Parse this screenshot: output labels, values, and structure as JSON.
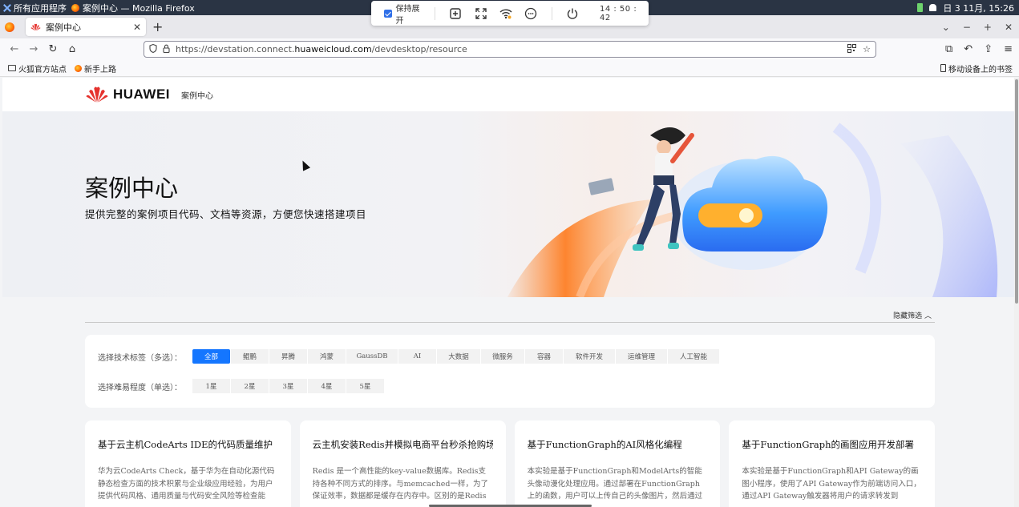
{
  "os": {
    "apps_label": "所有应用程序",
    "window_title": "案例中心 — Mozilla Firefox",
    "datetime": "日 3 11月, 15:26"
  },
  "remote_toolbar": {
    "keep_expanded": "保持展开",
    "clock": "14 : 50 : 42"
  },
  "browser": {
    "tab_title": "案例中心",
    "url_prefix": "https://devstation.connect.",
    "url_domain": "huaweicloud.com",
    "url_path": "/devdesktop/resource",
    "bookmarks": [
      "火狐官方站点",
      "新手上路"
    ],
    "mobile_bookmarks": "移动设备上的书签"
  },
  "site": {
    "brand": "HUAWEI",
    "section": "案例中心",
    "banner_title": "案例中心",
    "banner_subtitle": "提供完整的案例项目代码、文档等资源，方便您快速搭建项目",
    "toggle_filter": "隐藏筛选 ︿"
  },
  "filters": {
    "tech_label": "选择技术标签（多选）：",
    "tech_tags": [
      "全部",
      "鲲鹏",
      "昇腾",
      "鸿蒙",
      "GaussDB",
      "AI",
      "大数据",
      "微服务",
      "容器",
      "软件开发",
      "运维管理",
      "人工智能"
    ],
    "difficulty_label": "选择难易程度（单选）：",
    "difficulty_tags": [
      "1星",
      "2星",
      "3星",
      "4星",
      "5星"
    ]
  },
  "cards": [
    {
      "title": "基于云主机CodeArts IDE的代码质量维护",
      "desc": "华为云CodeArts Check，基于华为在自动化源代码静态检查方面的技术积累与企业级应用经验，为用户提供代码风格、通用质量与代码安全风险等检查能力，并..."
    },
    {
      "title": "云主机安装Redis并模拟电商平台秒杀抢购场景",
      "desc": "Redis 是一个高性能的key-value数据库。Redis支持各种不同方式的排序。与memcached一样，为了保证效率，数据都是缓存在内存中。区别的是Redis会周期..."
    },
    {
      "title": "基于FunctionGraph的AI风格化编程",
      "desc": "本实验是基于FunctionGraph和ModelArts的智能头像动漫化处理应用。通过部署在FunctionGraph上的函数，用户可以上传自己的头像图片，然后通过调用..."
    },
    {
      "title": "基于FunctionGraph的画图应用开发部署",
      "desc": "本实验是基于FunctionGraph和API Gateway的画图小程序，使用了API Gateway作为前端访问入口，通过API Gateway触发器将用户的请求转发到FunctionG..."
    }
  ]
}
